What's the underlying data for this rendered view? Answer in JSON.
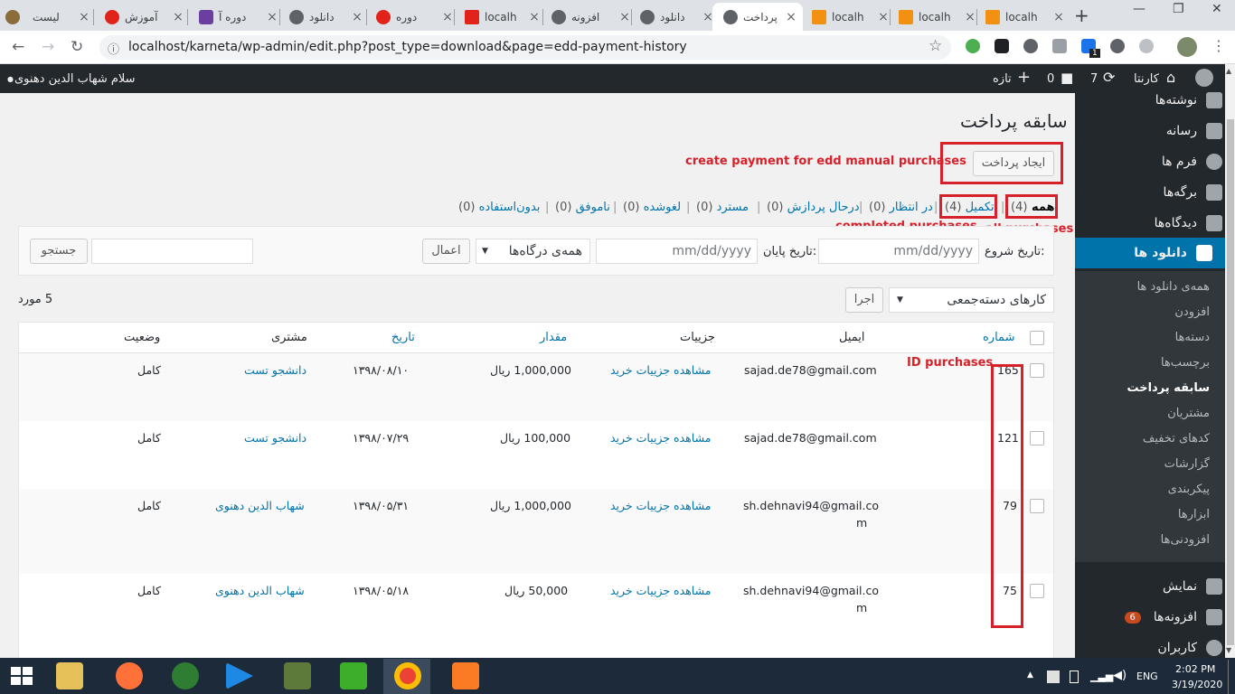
{
  "browser": {
    "tabs": [
      {
        "title": "لیست"
      },
      {
        "title": "آموزش"
      },
      {
        "title": "دوره آ"
      },
      {
        "title": "دانلود"
      },
      {
        "title": "دوره"
      },
      {
        "title": "localh"
      },
      {
        "title": "افزونه"
      },
      {
        "title": "دانلود"
      },
      {
        "title": "پرداخت",
        "active": true
      },
      {
        "title": "localh"
      },
      {
        "title": "localh"
      },
      {
        "title": "localh"
      }
    ],
    "url": "localhost/karneta/wp-admin/edit.php?post_type=download&page=edd-payment-history",
    "ext_badge": "1"
  },
  "admin_bar": {
    "greeting": "سلام شهاب الدین دهنوی",
    "site_name": "کارنتا",
    "updates": "7",
    "comments": "0",
    "new_label": "تازه"
  },
  "sidebar": {
    "items": [
      {
        "label": "نوشته‌ها"
      },
      {
        "label": "رسانه"
      },
      {
        "label": "فرم ها"
      },
      {
        "label": "برگه‌ها"
      },
      {
        "label": "دیدگاه‌ها"
      },
      {
        "label": "دانلود ها"
      }
    ],
    "submenu": [
      {
        "label": "همه‌ی دانلود ها"
      },
      {
        "label": "افزودن"
      },
      {
        "label": "دسته‌ها"
      },
      {
        "label": "برچسب‌ها"
      },
      {
        "label": "سابقه پرداخت"
      },
      {
        "label": "مشتریان"
      },
      {
        "label": "کدهای تخفیف"
      },
      {
        "label": "گزارشات"
      },
      {
        "label": "پیکربندی"
      },
      {
        "label": "ابزارها"
      },
      {
        "label": "افزودنی‌ها"
      }
    ],
    "bottom": [
      {
        "label": "نمایش"
      },
      {
        "label": "افزونه‌ها",
        "badge": "6"
      },
      {
        "label": "کاربران"
      }
    ]
  },
  "page": {
    "title": "سابقه پرداخت",
    "create_button": "ایجاد پرداخت",
    "statuses": [
      {
        "label": "همه",
        "count": "(4)"
      },
      {
        "label": "تکمیل",
        "count": "(4)"
      },
      {
        "label": "در انتظار",
        "count": "(0)"
      },
      {
        "label": "درحال پردازش",
        "count": "(0)"
      },
      {
        "label": "مسترد",
        "count": "(0)"
      },
      {
        "label": "لغوشده",
        "count": "(0)"
      },
      {
        "label": "ناموفق",
        "count": "(0)"
      },
      {
        "label": "بدون‌استفاده",
        "count": "(0)"
      }
    ],
    "filter": {
      "start_label": "تاریخ شروع:",
      "end_label": "تاریخ پایان:",
      "date_placeholder": "mm/dd/yyyy",
      "gateway": "همه‌ی درگاه‌ها",
      "apply": "اعمال",
      "search": "جستجو"
    },
    "bulk": {
      "select": "کارهای دسته‌جمعی",
      "apply": "اجرا"
    },
    "item_count": "5 مورد",
    "columns": [
      "شماره",
      "ایمیل",
      "جزییات",
      "مقدار",
      "تاریخ",
      "مشتری",
      "وضعیت"
    ],
    "rows": [
      {
        "id": "165",
        "email": "sajad.de78@gmail.com",
        "email2": "",
        "details": "مشاهده جزییات خرید",
        "amount": "1,000,000 ریال",
        "date": "۱۳۹۸/۰۸/۱۰",
        "customer": "دانشجو تست",
        "status": "کامل"
      },
      {
        "id": "121",
        "email": "sajad.de78@gmail.com",
        "email2": "",
        "details": "مشاهده جزییات خرید",
        "amount": "100,000 ریال",
        "date": "۱۳۹۸/۰۷/۲۹",
        "customer": "دانشجو تست",
        "status": "کامل"
      },
      {
        "id": "79",
        "email": "sh.dehnavi94@gmail.co",
        "email2": "m",
        "details": "مشاهده جزییات خرید",
        "amount": "1,000,000 ریال",
        "date": "۱۳۹۸/۰۵/۳۱",
        "customer": "شهاب الدین دهنوی",
        "status": "کامل"
      },
      {
        "id": "75",
        "email": "sh.dehnavi94@gmail.co",
        "email2": "m",
        "details": "مشاهده جزییات خرید",
        "amount": "50,000 ریال",
        "date": "۱۳۹۸/۰۵/۱۸",
        "customer": "شهاب الدین دهنوی",
        "status": "کامل"
      }
    ]
  },
  "annotations": {
    "create": "create payment for edd manual purchases",
    "completed": "completed purchases",
    "all": "all purchases",
    "id": "ID purchases"
  },
  "taskbar": {
    "lang": "ENG",
    "time": "2:02 PM",
    "date": "3/19/2020"
  },
  "colors": {
    "accent": "#0073aa",
    "annotation_red": "#d6202a",
    "admin_dark": "#23282d"
  }
}
